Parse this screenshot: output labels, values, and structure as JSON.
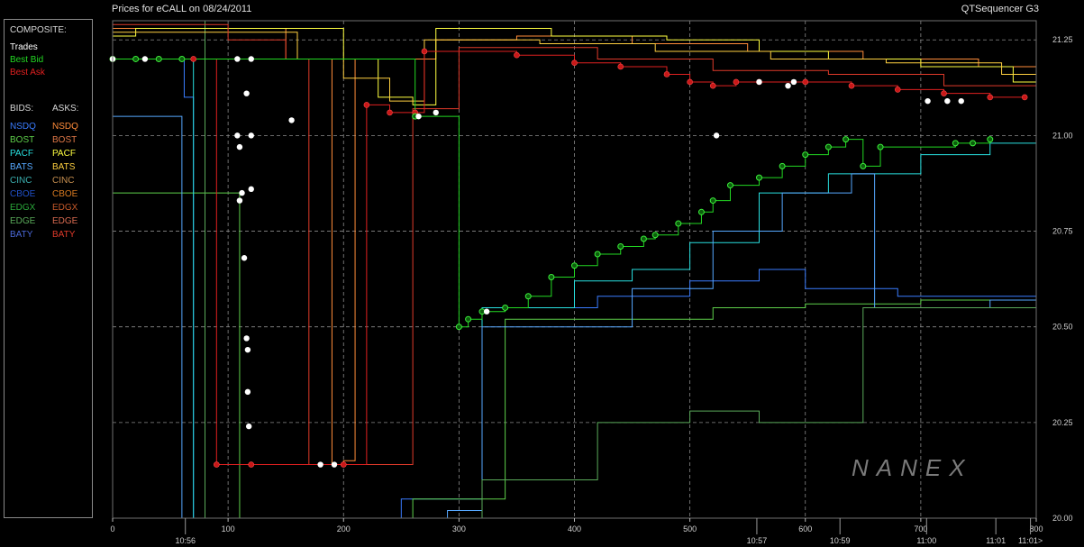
{
  "header": {
    "title": "Prices for  eCALL  on  08/24/2011",
    "app_name": "QTSequencer G3"
  },
  "legend": {
    "composite_label": "COMPOSITE:",
    "composite_items": [
      {
        "label": "Trades",
        "color": "#ffffff"
      },
      {
        "label": "Best Bid",
        "color": "#22d822"
      },
      {
        "label": "Best Ask",
        "color": "#e02020"
      }
    ],
    "bids_label": "BIDS:",
    "asks_label": "ASKS:",
    "bids": [
      {
        "label": "NSDQ",
        "color": "#3a7cff"
      },
      {
        "label": "BOST",
        "color": "#5ecf4a"
      },
      {
        "label": "PACF",
        "color": "#28e0e0"
      },
      {
        "label": "BATS",
        "color": "#56a8ff"
      },
      {
        "label": "CINC",
        "color": "#3bb0b0"
      },
      {
        "label": "CBOE",
        "color": "#2050c8"
      },
      {
        "label": "EDGX",
        "color": "#2aa83a"
      },
      {
        "label": "EDGE",
        "color": "#5aaa5a"
      },
      {
        "label": "BATY",
        "color": "#4a68d8"
      }
    ],
    "asks": [
      {
        "label": "NSDQ",
        "color": "#ff8c3a"
      },
      {
        "label": "BOST",
        "color": "#e07848"
      },
      {
        "label": "PACF",
        "color": "#ffff40"
      },
      {
        "label": "BATS",
        "color": "#ffd040"
      },
      {
        "label": "CINC",
        "color": "#c89050"
      },
      {
        "label": "CBOE",
        "color": "#d87a20"
      },
      {
        "label": "EDGX",
        "color": "#c85a2a"
      },
      {
        "label": "EDGE",
        "color": "#d86a50"
      },
      {
        "label": "BATY",
        "color": "#e03a2a"
      }
    ]
  },
  "watermark": "NANEX",
  "chart_data": {
    "type": "line",
    "title": "Prices for  eCALL  on  08/24/2011",
    "ylim": [
      20.0,
      21.3
    ],
    "xlim": [
      0,
      800
    ],
    "grid": true,
    "y_ticks": [
      "21.25",
      "21.00",
      "20.75",
      "20.50",
      "20.25",
      "20.00"
    ],
    "x_ticks": [
      "0",
      "100",
      "200",
      "300",
      "400",
      "500",
      "600",
      "700",
      "800"
    ],
    "time_labels": [
      {
        "label": "10:56",
        "x": 63
      },
      {
        "label": "10:57",
        "x": 558
      },
      {
        "label": "10:59",
        "x": 630
      },
      {
        "label": "11:00",
        "x": 705
      },
      {
        "label": "11:01",
        "x": 765
      },
      {
        "label": "11:01>",
        "x": 795
      }
    ],
    "trades": [
      [
        0,
        21.2
      ],
      [
        28,
        21.2
      ],
      [
        108,
        21.2
      ],
      [
        120,
        21.2
      ],
      [
        116,
        21.11
      ],
      [
        155,
        21.04
      ],
      [
        108,
        21.0
      ],
      [
        110,
        20.97
      ],
      [
        120,
        21.0
      ],
      [
        112,
        20.85
      ],
      [
        110,
        20.83
      ],
      [
        120,
        20.86
      ],
      [
        114,
        20.68
      ],
      [
        116,
        20.47
      ],
      [
        117,
        20.44
      ],
      [
        117,
        20.33
      ],
      [
        118,
        20.24
      ],
      [
        180,
        20.14
      ],
      [
        192,
        20.14
      ],
      [
        265,
        21.05
      ],
      [
        280,
        21.06
      ],
      [
        324,
        20.54
      ],
      [
        523,
        21.0
      ],
      [
        560,
        21.14
      ],
      [
        585,
        21.13
      ],
      [
        590,
        21.14
      ],
      [
        706,
        21.09
      ],
      [
        723,
        21.09
      ],
      [
        735,
        21.09
      ]
    ],
    "best_bid": [
      [
        0,
        21.2
      ],
      [
        20,
        21.2
      ],
      [
        40,
        21.2
      ],
      [
        60,
        21.2
      ],
      [
        262,
        21.05
      ],
      [
        300,
        20.5
      ],
      [
        308,
        20.52
      ],
      [
        320,
        20.54
      ],
      [
        340,
        20.55
      ],
      [
        360,
        20.58
      ],
      [
        380,
        20.63
      ],
      [
        400,
        20.66
      ],
      [
        420,
        20.69
      ],
      [
        440,
        20.71
      ],
      [
        460,
        20.73
      ],
      [
        470,
        20.74
      ],
      [
        490,
        20.77
      ],
      [
        510,
        20.8
      ],
      [
        520,
        20.83
      ],
      [
        535,
        20.87
      ],
      [
        560,
        20.89
      ],
      [
        580,
        20.92
      ],
      [
        600,
        20.95
      ],
      [
        620,
        20.97
      ],
      [
        635,
        20.99
      ],
      [
        650,
        20.92
      ],
      [
        665,
        20.97
      ],
      [
        730,
        20.98
      ],
      [
        745,
        20.98
      ],
      [
        760,
        20.99
      ]
    ],
    "best_ask": [
      [
        0,
        21.2
      ],
      [
        40,
        21.2
      ],
      [
        70,
        21.2
      ],
      [
        90,
        20.14
      ],
      [
        120,
        20.14
      ],
      [
        200,
        20.14
      ],
      [
        220,
        21.08
      ],
      [
        240,
        21.06
      ],
      [
        262,
        21.06
      ],
      [
        270,
        21.22
      ],
      [
        350,
        21.21
      ],
      [
        400,
        21.19
      ],
      [
        440,
        21.18
      ],
      [
        480,
        21.16
      ],
      [
        500,
        21.14
      ],
      [
        520,
        21.13
      ],
      [
        540,
        21.14
      ],
      [
        560,
        21.14
      ],
      [
        600,
        21.14
      ],
      [
        640,
        21.13
      ],
      [
        680,
        21.12
      ],
      [
        720,
        21.11
      ],
      [
        760,
        21.1
      ],
      [
        790,
        21.1
      ]
    ],
    "bid_series": [
      {
        "name": "NSDQ",
        "color": "#3a7cff",
        "points": [
          [
            0,
            21.2
          ],
          [
            55,
            21.2
          ],
          [
            62,
            21.1
          ],
          [
            70,
            20.0
          ],
          [
            180,
            20.0
          ],
          [
            250,
            20.05
          ],
          [
            300,
            20.05
          ],
          [
            320,
            20.55
          ],
          [
            420,
            20.58
          ],
          [
            500,
            20.62
          ],
          [
            560,
            20.65
          ],
          [
            600,
            20.6
          ],
          [
            680,
            20.58
          ],
          [
            720,
            20.58
          ],
          [
            770,
            20.58
          ],
          [
            800,
            20.58
          ]
        ]
      },
      {
        "name": "BOST",
        "color": "#5ecf4a",
        "points": [
          [
            0,
            20.85
          ],
          [
            100,
            20.85
          ],
          [
            110,
            20.0
          ],
          [
            260,
            20.05
          ],
          [
            320,
            20.05
          ],
          [
            340,
            20.52
          ],
          [
            520,
            20.55
          ],
          [
            600,
            20.56
          ],
          [
            700,
            20.57
          ],
          [
            800,
            20.55
          ]
        ]
      },
      {
        "name": "PACF",
        "color": "#28e0e0",
        "points": [
          [
            0,
            21.2
          ],
          [
            60,
            21.2
          ],
          [
            70,
            20.0
          ],
          [
            300,
            20.0
          ],
          [
            320,
            20.55
          ],
          [
            400,
            20.62
          ],
          [
            450,
            20.65
          ],
          [
            500,
            20.72
          ],
          [
            560,
            20.85
          ],
          [
            620,
            20.9
          ],
          [
            700,
            20.95
          ],
          [
            760,
            20.98
          ],
          [
            800,
            20.99
          ]
        ]
      },
      {
        "name": "BATS",
        "color": "#56a8ff",
        "points": [
          [
            0,
            21.05
          ],
          [
            50,
            21.05
          ],
          [
            60,
            20.0
          ],
          [
            290,
            20.02
          ],
          [
            320,
            20.5
          ],
          [
            450,
            20.6
          ],
          [
            520,
            20.75
          ],
          [
            580,
            20.85
          ],
          [
            640,
            20.9
          ],
          [
            660,
            20.55
          ],
          [
            760,
            20.57
          ],
          [
            800,
            20.6
          ]
        ]
      },
      {
        "name": "EDGE",
        "color": "#5aaa5a",
        "points": [
          [
            0,
            21.3
          ],
          [
            70,
            21.3
          ],
          [
            80,
            20.0
          ],
          [
            320,
            20.1
          ],
          [
            420,
            20.25
          ],
          [
            500,
            20.28
          ],
          [
            560,
            20.25
          ],
          [
            620,
            20.25
          ],
          [
            650,
            20.55
          ],
          [
            720,
            20.55
          ],
          [
            800,
            20.55
          ]
        ]
      }
    ],
    "ask_series": [
      {
        "name": "NSDQ",
        "color": "#ff8c3a",
        "points": [
          [
            0,
            21.28
          ],
          [
            100,
            21.28
          ],
          [
            150,
            21.2
          ],
          [
            190,
            20.14
          ],
          [
            200,
            20.15
          ],
          [
            210,
            21.2
          ],
          [
            280,
            21.25
          ],
          [
            350,
            21.26
          ],
          [
            450,
            21.24
          ],
          [
            550,
            21.22
          ],
          [
            650,
            21.2
          ],
          [
            750,
            21.18
          ],
          [
            800,
            21.12
          ]
        ]
      },
      {
        "name": "PACF",
        "color": "#ffff40",
        "points": [
          [
            0,
            21.26
          ],
          [
            20,
            21.28
          ],
          [
            200,
            21.2
          ],
          [
            230,
            21.1
          ],
          [
            260,
            21.08
          ],
          [
            280,
            21.28
          ],
          [
            380,
            21.26
          ],
          [
            480,
            21.25
          ],
          [
            560,
            21.22
          ],
          [
            620,
            21.2
          ],
          [
            700,
            21.18
          ],
          [
            780,
            21.14
          ],
          [
            800,
            21.12
          ]
        ]
      },
      {
        "name": "BATS",
        "color": "#ffd040",
        "points": [
          [
            0,
            21.27
          ],
          [
            80,
            21.27
          ],
          [
            160,
            21.2
          ],
          [
            200,
            21.15
          ],
          [
            240,
            21.09
          ],
          [
            270,
            21.25
          ],
          [
            370,
            21.24
          ],
          [
            470,
            21.22
          ],
          [
            570,
            21.2
          ],
          [
            670,
            21.19
          ],
          [
            770,
            21.16
          ],
          [
            800,
            21.14
          ]
        ]
      },
      {
        "name": "BATY",
        "color": "#e03a2a",
        "points": [
          [
            0,
            21.29
          ],
          [
            100,
            21.25
          ],
          [
            150,
            21.2
          ],
          [
            170,
            20.14
          ],
          [
            190,
            20.14
          ],
          [
            260,
            21.07
          ],
          [
            300,
            21.23
          ],
          [
            420,
            21.2
          ],
          [
            520,
            21.17
          ],
          [
            620,
            21.16
          ],
          [
            720,
            21.13
          ],
          [
            800,
            21.1
          ]
        ]
      }
    ]
  }
}
